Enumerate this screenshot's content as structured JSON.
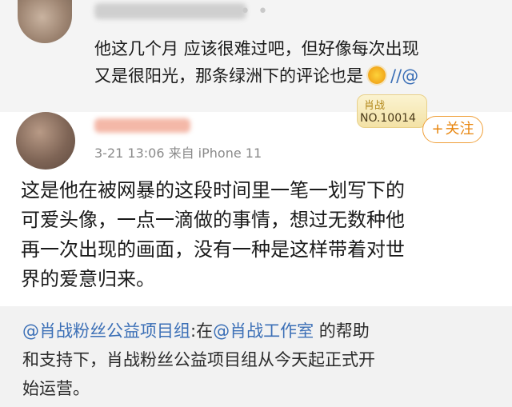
{
  "comment": {
    "text_line1": "他这几个月 应该很难过吧，但好像每次出现",
    "text_line2_before": "又是很阳光，那条绿洲下的评论也是",
    "text_line2_mention": "//@",
    "sun_emoji": "sun-emoji"
  },
  "post": {
    "badge_title": "肖战",
    "badge_number": "NO.10014",
    "follow_label": "关注",
    "follow_plus": "+",
    "meta": "3-21 13:06  来自 iPhone 11",
    "lines": [
      "这是他在被网暴的这段时间里一笔一划写下的",
      "可爱头像，一点一滴做的事情，想过无数种他",
      "再一次出现的画面，没有一种是这样带着对世",
      "界的爱意归来。"
    ]
  },
  "repost": {
    "mention1": "@肖战粉丝公益项目组",
    "text1": ":在",
    "mention2": "@肖战工作室",
    "text2": " 的帮助",
    "line2": "和支持下，肖战粉丝公益项目组从今天起正式开",
    "line3": "始运营。"
  },
  "colors": {
    "link": "#3b6fb6",
    "follow": "#e8860f",
    "meta": "#8a8a8a"
  }
}
